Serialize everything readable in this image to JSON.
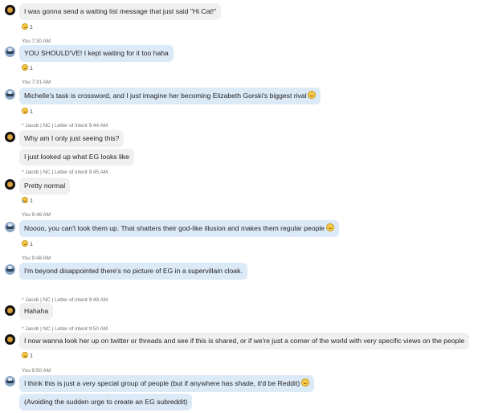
{
  "messages": [
    {
      "text": "I was gonna send a waiting list message that just said \"Hi Cat!\"",
      "reaction": {
        "icon": "laughing-emoji-icon",
        "count": "1"
      }
    },
    {
      "meta": "You 7:30 AM",
      "text": "YOU SHOULD'VE! I kept waiting for it too haha",
      "reaction": {
        "icon": "laughing-emoji-icon",
        "count": "1"
      }
    },
    {
      "meta": "You 7:31 AM",
      "text": "Michelle's task is crossword, and I just imagine her becoming Elizabeth Gorski's biggest rival",
      "reaction": {
        "icon": "laughing-emoji-icon",
        "count": "1"
      }
    },
    {
      "meta": "* Jacob | NC | Letter of intent 9:44 AM",
      "text": "Why am I only just seeing this?"
    },
    {
      "text": "I just looked up what EG looks like"
    },
    {
      "meta": "* Jacob | NC | Letter of intent 9:45 AM",
      "text": "Pretty normal",
      "reaction": {
        "icon": "crying-laughing-emoji-icon",
        "count": "1"
      }
    },
    {
      "meta": "You 9:48 AM",
      "text": "Noooo, you can't look them up. That shatters their god-like illusion and makes them regular people",
      "reaction": {
        "icon": "laughing-emoji-icon",
        "count": "1"
      }
    },
    {
      "meta": "You 9:48 AM",
      "text": "I'm beyond disappointed there's no picture of EG in a supervillain cloak."
    },
    {
      "meta": "* Jacob | NC | Letter of intent 9:49 AM",
      "text": "Hahaha"
    },
    {
      "meta": "* Jacob | NC | Letter of intent 9:50 AM",
      "text": "I now wanna look her up on twitter or threads and see if this is shared, or if we're just a corner of the world with very specific views on the people",
      "reaction": {
        "icon": "laughing-emoji-icon",
        "count": "1"
      }
    },
    {
      "meta": "You 9:50 AM",
      "text": "I think this is just a very special group of people (but if anywhere has shade, it'd be Reddit)"
    },
    {
      "text": "(Avoiding the sudden urge to create an EG subreddit)"
    }
  ]
}
